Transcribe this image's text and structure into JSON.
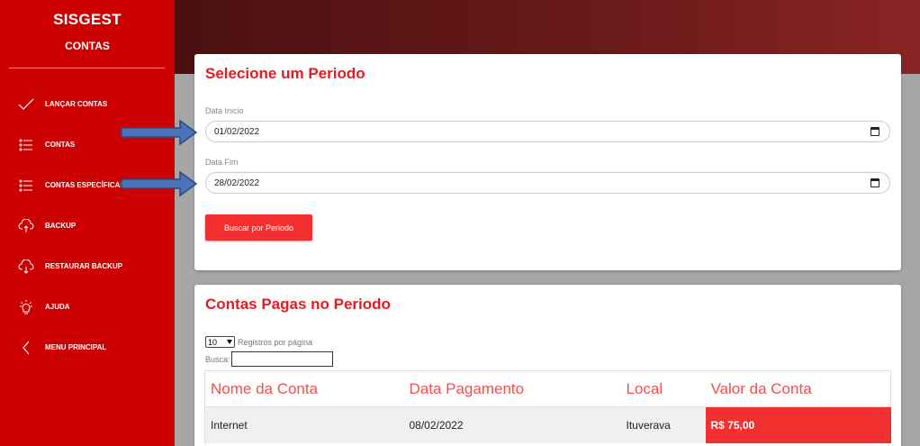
{
  "app": {
    "title": "SISGEST",
    "section": "CONTAS"
  },
  "sidebar": {
    "items": [
      {
        "label": "LANÇAR CONTAS",
        "icon": "check-icon"
      },
      {
        "label": "CONTAS",
        "icon": "list-icon"
      },
      {
        "label": "CONTAS ESPECÍFICAS",
        "icon": "list-icon"
      },
      {
        "label": "BACKUP",
        "icon": "cloud-upload-icon"
      },
      {
        "label": "RESTAURAR BACKUP",
        "icon": "cloud-download-icon"
      },
      {
        "label": "AJUDA",
        "icon": "lightbulb-icon"
      },
      {
        "label": "MENU PRINCIPAL",
        "icon": "chevron-left-icon"
      }
    ]
  },
  "period": {
    "title": "Selecione um Periodo",
    "start_label": "Data Inicio",
    "start_value": "01/02/2022",
    "end_label": "Data Fim",
    "end_value": "28/02/2022",
    "search_button": "Buscar por Periodo"
  },
  "paid": {
    "title": "Contas Pagas no Periodo",
    "per_page_value": "10",
    "per_page_label": "Registros por página",
    "search_label": "Busca:",
    "columns": [
      "Nome da Conta",
      "Data Pagamento",
      "Local",
      "Valor da Conta"
    ],
    "rows": [
      {
        "nome": "Internet",
        "data": "08/02/2022",
        "local": "Ituverava",
        "valor": "R$ 75,00"
      }
    ]
  },
  "colors": {
    "sidebar": "#cc0000",
    "accent": "#e31b23",
    "button": "#f23030"
  }
}
